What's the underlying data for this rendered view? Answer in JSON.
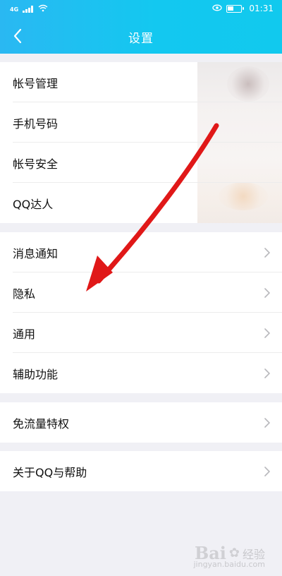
{
  "status_bar": {
    "time": "01:31",
    "network": "4G"
  },
  "nav": {
    "title": "设置",
    "back_icon": "chevron-left-icon"
  },
  "groups": [
    {
      "items": [
        {
          "label": "帐号管理"
        },
        {
          "label": "手机号码"
        },
        {
          "label": "帐号安全"
        },
        {
          "label": "QQ达人"
        }
      ]
    },
    {
      "items": [
        {
          "label": "消息通知"
        },
        {
          "label": "隐私"
        },
        {
          "label": "通用"
        },
        {
          "label": "辅助功能"
        }
      ]
    },
    {
      "items": [
        {
          "label": "免流量特权"
        }
      ]
    },
    {
      "items": [
        {
          "label": "关于QQ与帮助"
        }
      ]
    }
  ],
  "annotation": {
    "arrow_color": "#e01818",
    "points_to": "隐私"
  },
  "watermark": {
    "brand": "Bai",
    "text": "经验",
    "sub": "jingyan.baidu.com"
  },
  "colors": {
    "header_start": "#2ab8f2",
    "header_end": "#11c9ee",
    "background": "#f0f0f5",
    "chevron": "#b8b8bc"
  }
}
